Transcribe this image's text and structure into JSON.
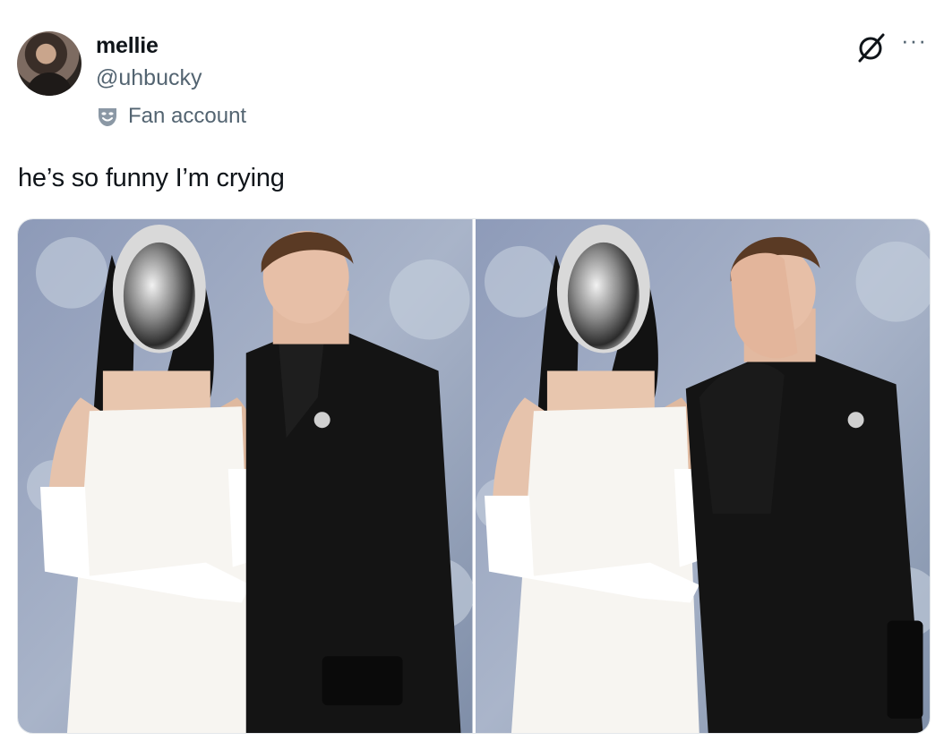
{
  "author": {
    "display_name": "mellie",
    "handle": "@uhbucky",
    "affiliation_label": "Fan account",
    "affiliation_icon": "theater-mask-icon"
  },
  "tweet": {
    "text": "he’s so funny I’m crying"
  },
  "header_icons": [
    "grok-icon",
    "more-icon"
  ],
  "more_glyph": "···",
  "media": {
    "count": 2,
    "items": [
      {
        "name": "photo-couple-facing-camera"
      },
      {
        "name": "photo-man-covering-face"
      }
    ]
  },
  "colors": {
    "text_primary": "#0f1419",
    "text_secondary": "#536471"
  }
}
